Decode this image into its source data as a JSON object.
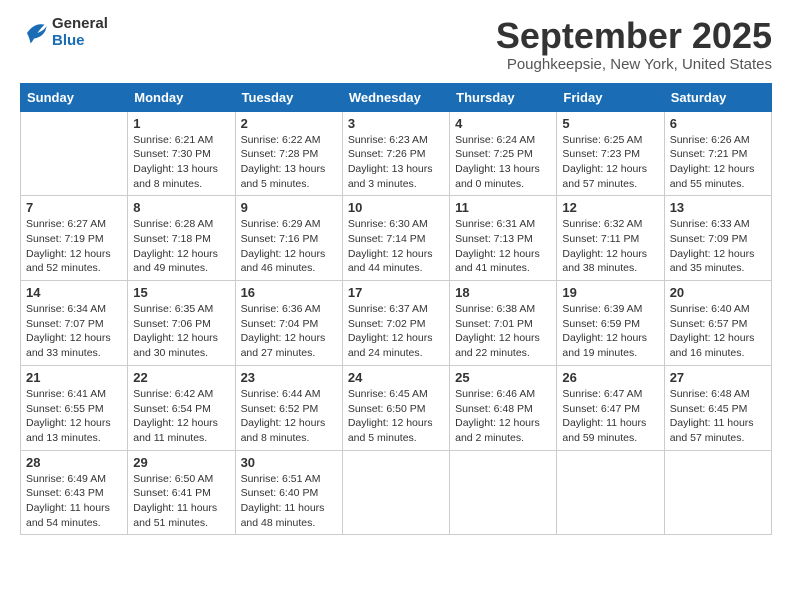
{
  "logo": {
    "text_general": "General",
    "text_blue": "Blue"
  },
  "title": "September 2025",
  "subtitle": "Poughkeepsie, New York, United States",
  "days": [
    "Sunday",
    "Monday",
    "Tuesday",
    "Wednesday",
    "Thursday",
    "Friday",
    "Saturday"
  ],
  "weeks": [
    [
      {
        "date": "",
        "sunrise": "",
        "sunset": "",
        "daylight": ""
      },
      {
        "date": "1",
        "sunrise": "Sunrise: 6:21 AM",
        "sunset": "Sunset: 7:30 PM",
        "daylight": "Daylight: 13 hours and 8 minutes."
      },
      {
        "date": "2",
        "sunrise": "Sunrise: 6:22 AM",
        "sunset": "Sunset: 7:28 PM",
        "daylight": "Daylight: 13 hours and 5 minutes."
      },
      {
        "date": "3",
        "sunrise": "Sunrise: 6:23 AM",
        "sunset": "Sunset: 7:26 PM",
        "daylight": "Daylight: 13 hours and 3 minutes."
      },
      {
        "date": "4",
        "sunrise": "Sunrise: 6:24 AM",
        "sunset": "Sunset: 7:25 PM",
        "daylight": "Daylight: 13 hours and 0 minutes."
      },
      {
        "date": "5",
        "sunrise": "Sunrise: 6:25 AM",
        "sunset": "Sunset: 7:23 PM",
        "daylight": "Daylight: 12 hours and 57 minutes."
      },
      {
        "date": "6",
        "sunrise": "Sunrise: 6:26 AM",
        "sunset": "Sunset: 7:21 PM",
        "daylight": "Daylight: 12 hours and 55 minutes."
      }
    ],
    [
      {
        "date": "7",
        "sunrise": "Sunrise: 6:27 AM",
        "sunset": "Sunset: 7:19 PM",
        "daylight": "Daylight: 12 hours and 52 minutes."
      },
      {
        "date": "8",
        "sunrise": "Sunrise: 6:28 AM",
        "sunset": "Sunset: 7:18 PM",
        "daylight": "Daylight: 12 hours and 49 minutes."
      },
      {
        "date": "9",
        "sunrise": "Sunrise: 6:29 AM",
        "sunset": "Sunset: 7:16 PM",
        "daylight": "Daylight: 12 hours and 46 minutes."
      },
      {
        "date": "10",
        "sunrise": "Sunrise: 6:30 AM",
        "sunset": "Sunset: 7:14 PM",
        "daylight": "Daylight: 12 hours and 44 minutes."
      },
      {
        "date": "11",
        "sunrise": "Sunrise: 6:31 AM",
        "sunset": "Sunset: 7:13 PM",
        "daylight": "Daylight: 12 hours and 41 minutes."
      },
      {
        "date": "12",
        "sunrise": "Sunrise: 6:32 AM",
        "sunset": "Sunset: 7:11 PM",
        "daylight": "Daylight: 12 hours and 38 minutes."
      },
      {
        "date": "13",
        "sunrise": "Sunrise: 6:33 AM",
        "sunset": "Sunset: 7:09 PM",
        "daylight": "Daylight: 12 hours and 35 minutes."
      }
    ],
    [
      {
        "date": "14",
        "sunrise": "Sunrise: 6:34 AM",
        "sunset": "Sunset: 7:07 PM",
        "daylight": "Daylight: 12 hours and 33 minutes."
      },
      {
        "date": "15",
        "sunrise": "Sunrise: 6:35 AM",
        "sunset": "Sunset: 7:06 PM",
        "daylight": "Daylight: 12 hours and 30 minutes."
      },
      {
        "date": "16",
        "sunrise": "Sunrise: 6:36 AM",
        "sunset": "Sunset: 7:04 PM",
        "daylight": "Daylight: 12 hours and 27 minutes."
      },
      {
        "date": "17",
        "sunrise": "Sunrise: 6:37 AM",
        "sunset": "Sunset: 7:02 PM",
        "daylight": "Daylight: 12 hours and 24 minutes."
      },
      {
        "date": "18",
        "sunrise": "Sunrise: 6:38 AM",
        "sunset": "Sunset: 7:01 PM",
        "daylight": "Daylight: 12 hours and 22 minutes."
      },
      {
        "date": "19",
        "sunrise": "Sunrise: 6:39 AM",
        "sunset": "Sunset: 6:59 PM",
        "daylight": "Daylight: 12 hours and 19 minutes."
      },
      {
        "date": "20",
        "sunrise": "Sunrise: 6:40 AM",
        "sunset": "Sunset: 6:57 PM",
        "daylight": "Daylight: 12 hours and 16 minutes."
      }
    ],
    [
      {
        "date": "21",
        "sunrise": "Sunrise: 6:41 AM",
        "sunset": "Sunset: 6:55 PM",
        "daylight": "Daylight: 12 hours and 13 minutes."
      },
      {
        "date": "22",
        "sunrise": "Sunrise: 6:42 AM",
        "sunset": "Sunset: 6:54 PM",
        "daylight": "Daylight: 12 hours and 11 minutes."
      },
      {
        "date": "23",
        "sunrise": "Sunrise: 6:44 AM",
        "sunset": "Sunset: 6:52 PM",
        "daylight": "Daylight: 12 hours and 8 minutes."
      },
      {
        "date": "24",
        "sunrise": "Sunrise: 6:45 AM",
        "sunset": "Sunset: 6:50 PM",
        "daylight": "Daylight: 12 hours and 5 minutes."
      },
      {
        "date": "25",
        "sunrise": "Sunrise: 6:46 AM",
        "sunset": "Sunset: 6:48 PM",
        "daylight": "Daylight: 12 hours and 2 minutes."
      },
      {
        "date": "26",
        "sunrise": "Sunrise: 6:47 AM",
        "sunset": "Sunset: 6:47 PM",
        "daylight": "Daylight: 11 hours and 59 minutes."
      },
      {
        "date": "27",
        "sunrise": "Sunrise: 6:48 AM",
        "sunset": "Sunset: 6:45 PM",
        "daylight": "Daylight: 11 hours and 57 minutes."
      }
    ],
    [
      {
        "date": "28",
        "sunrise": "Sunrise: 6:49 AM",
        "sunset": "Sunset: 6:43 PM",
        "daylight": "Daylight: 11 hours and 54 minutes."
      },
      {
        "date": "29",
        "sunrise": "Sunrise: 6:50 AM",
        "sunset": "Sunset: 6:41 PM",
        "daylight": "Daylight: 11 hours and 51 minutes."
      },
      {
        "date": "30",
        "sunrise": "Sunrise: 6:51 AM",
        "sunset": "Sunset: 6:40 PM",
        "daylight": "Daylight: 11 hours and 48 minutes."
      },
      {
        "date": "",
        "sunrise": "",
        "sunset": "",
        "daylight": ""
      },
      {
        "date": "",
        "sunrise": "",
        "sunset": "",
        "daylight": ""
      },
      {
        "date": "",
        "sunrise": "",
        "sunset": "",
        "daylight": ""
      },
      {
        "date": "",
        "sunrise": "",
        "sunset": "",
        "daylight": ""
      }
    ]
  ]
}
